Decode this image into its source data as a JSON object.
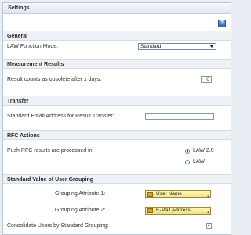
{
  "panel": {
    "title": "Settings"
  },
  "help": {
    "glyph": "?"
  },
  "general": {
    "section_title": "General",
    "law_mode_label": "LAW Function Mode:",
    "law_mode_value": "Standard"
  },
  "measurement": {
    "section_title": "Measurement Results",
    "obsolete_label": "Result counts as obsolete after x days:",
    "obsolete_value": "0"
  },
  "transfer": {
    "section_title": "Transfer",
    "email_label": "Standard Email Address for Result Transfer:",
    "email_value": ""
  },
  "rfc": {
    "section_title": "RFC Actions",
    "push_label": "Push RFC results are processed in:",
    "options": [
      {
        "label": "LAW 2.0",
        "checked": true
      },
      {
        "label": "LAW",
        "checked": false
      }
    ]
  },
  "grouping": {
    "section_title": "Standard Value of User Grouping",
    "attr1_label": "Grouping Attribute 1:",
    "attr1_value": "User Name",
    "attr2_label": "Grouping Attribute 2:",
    "attr2_value": "E-Mail Address",
    "consolidate_label": "Consolidate Users by Standard Grouping:",
    "consolidate_checked": true,
    "check_glyph": "✓"
  }
}
